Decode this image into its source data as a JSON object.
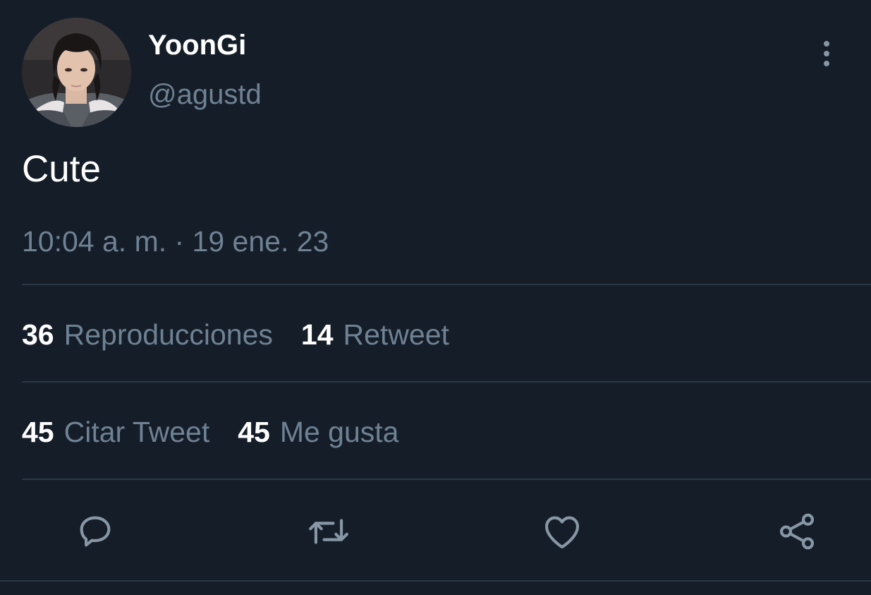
{
  "author": {
    "display_name": "YoonGi",
    "handle": "@agustd",
    "avatar_icon": "profile-photo"
  },
  "tweet": {
    "text": "Cute",
    "timestamp": "10:04 a. m. · 19 ene. 23"
  },
  "stats": [
    {
      "count": "36",
      "label": "Reproducciones"
    },
    {
      "count": "14",
      "label": "Retweet"
    },
    {
      "count": "45",
      "label": "Citar Tweet"
    },
    {
      "count": "45",
      "label": "Me gusta"
    }
  ],
  "actions": [
    "reply-icon",
    "retweet-icon",
    "like-icon",
    "share-icon"
  ],
  "colors": {
    "background": "#151d28",
    "secondary_text": "#6e8294",
    "icon": "#8797a6",
    "divider": "#2b3744"
  }
}
